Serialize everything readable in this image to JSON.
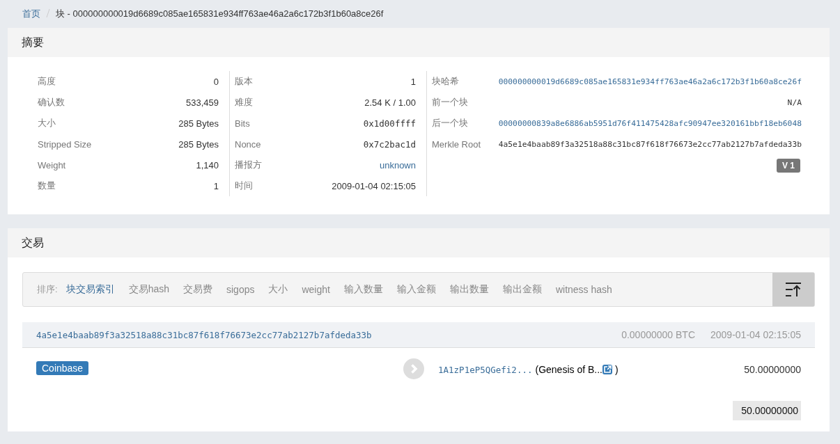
{
  "breadcrumb": {
    "home": "首页",
    "current": "块 - 000000000019d6689c085ae165831e934ff763ae46a2a6c172b3f1b60a8ce26f"
  },
  "summary": {
    "title": "摘要",
    "columns": [
      [
        {
          "label": "高度",
          "value": "0",
          "kind": "text"
        },
        {
          "label": "确认数",
          "value": "533,459",
          "kind": "text"
        },
        {
          "label": "大小",
          "value": "285 Bytes",
          "kind": "text"
        },
        {
          "label": "Stripped Size",
          "value": "285 Bytes",
          "kind": "text"
        },
        {
          "label": "Weight",
          "value": "1,140",
          "kind": "text"
        },
        {
          "label": "数量",
          "value": "1",
          "kind": "text"
        }
      ],
      [
        {
          "label": "版本",
          "value": "1",
          "kind": "text"
        },
        {
          "label": "难度",
          "value": "2.54 K / 1.00",
          "kind": "text"
        },
        {
          "label": "Bits",
          "value": "0x1d00ffff",
          "kind": "mono"
        },
        {
          "label": "Nonce",
          "value": "0x7c2bac1d",
          "kind": "mono"
        },
        {
          "label": "播报方",
          "value": "unknown",
          "kind": "link"
        },
        {
          "label": "时间",
          "value": "2009-01-04 02:15:05",
          "kind": "text"
        }
      ],
      [
        {
          "label": "块哈希",
          "value": "000000000019d6689c085ae165831e934ff763ae46a2a6c172b3f1b60a8ce26f",
          "kind": "monolink"
        },
        {
          "label": "前一个块",
          "value": "N/A",
          "kind": "mono"
        },
        {
          "label": "后一个块",
          "value": "00000000839a8e6886ab5951d76f411475428afc90947ee320161bbf18eb6048",
          "kind": "monolink"
        },
        {
          "label": "Merkle Root",
          "value": "4a5e1e4baab89f3a32518a88c31bc87f618f76673e2cc77ab2127b7afdeda33b",
          "kind": "mono"
        }
      ]
    ],
    "version_badge": "V 1"
  },
  "transactions": {
    "title": "交易",
    "sort_label": "排序:",
    "sort_options": [
      {
        "label": "块交易索引",
        "selected": true
      },
      {
        "label": "交易hash",
        "selected": false
      },
      {
        "label": "交易费",
        "selected": false
      },
      {
        "label": "sigops",
        "selected": false
      },
      {
        "label": "大小",
        "selected": false
      },
      {
        "label": "weight",
        "selected": false
      },
      {
        "label": "输入数量",
        "selected": false
      },
      {
        "label": "输入金额",
        "selected": false
      },
      {
        "label": "输出数量",
        "selected": false
      },
      {
        "label": "输出金额",
        "selected": false
      },
      {
        "label": "witness hash",
        "selected": false
      }
    ],
    "items": [
      {
        "hash": "4a5e1e4baab89f3a32518a88c31bc87f618f76673e2cc77ab2127b7afdeda33b",
        "fee": "0.00000000 BTC",
        "time": "2009-01-04 02:15:05",
        "inputs": [
          {
            "kind": "coinbase",
            "label": "Coinbase"
          }
        ],
        "outputs": [
          {
            "address": "1A1zP1eP5QGefi2...",
            "note": "(Genesis of B...",
            "note_end": ")",
            "amount": "50.00000000"
          }
        ],
        "total": "50.00000000"
      }
    ]
  }
}
